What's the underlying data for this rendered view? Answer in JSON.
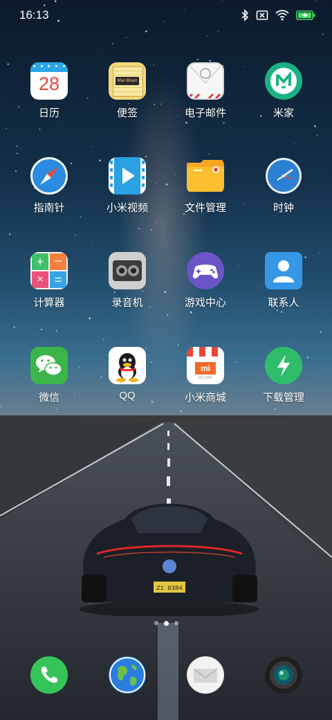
{
  "status_bar": {
    "time": "16:13",
    "icons": [
      "bluetooth-icon",
      "sim-no-signal-icon",
      "wifi-icon",
      "battery-charging-icon"
    ],
    "battery_color": "#4cd964"
  },
  "apps": [
    {
      "label": "日历",
      "icon": "calendar-icon",
      "calendar_day": "28"
    },
    {
      "label": "便签",
      "icon": "notes-icon",
      "notes_text": "Max Braun"
    },
    {
      "label": "电子邮件",
      "icon": "email-icon"
    },
    {
      "label": "米家",
      "icon": "mijia-icon"
    },
    {
      "label": "指南针",
      "icon": "compass-icon"
    },
    {
      "label": "小米视频",
      "icon": "video-icon"
    },
    {
      "label": "文件管理",
      "icon": "file-manager-icon"
    },
    {
      "label": "时钟",
      "icon": "clock-icon"
    },
    {
      "label": "计算器",
      "icon": "calculator-icon"
    },
    {
      "label": "录音机",
      "icon": "recorder-icon"
    },
    {
      "label": "游戏中心",
      "icon": "game-center-icon"
    },
    {
      "label": "联系人",
      "icon": "contacts-icon"
    },
    {
      "label": "微信",
      "icon": "wechat-icon"
    },
    {
      "label": "QQ",
      "icon": "qq-icon"
    },
    {
      "label": "小米商城",
      "icon": "mi-store-icon",
      "store_logo": "mi",
      "store_url": "mi.com"
    },
    {
      "label": "下载管理",
      "icon": "download-manager-icon"
    }
  ],
  "page_indicator": {
    "pages": 3,
    "active": 1
  },
  "dock": [
    {
      "icon": "phone-icon"
    },
    {
      "icon": "browser-icon"
    },
    {
      "icon": "messaging-icon"
    },
    {
      "icon": "camera-icon"
    }
  ],
  "wallpaper": {
    "license_plate": "Z1 0384"
  },
  "colors": {
    "accent_green": "#3cc35f",
    "calendar_red": "#e8443a"
  }
}
